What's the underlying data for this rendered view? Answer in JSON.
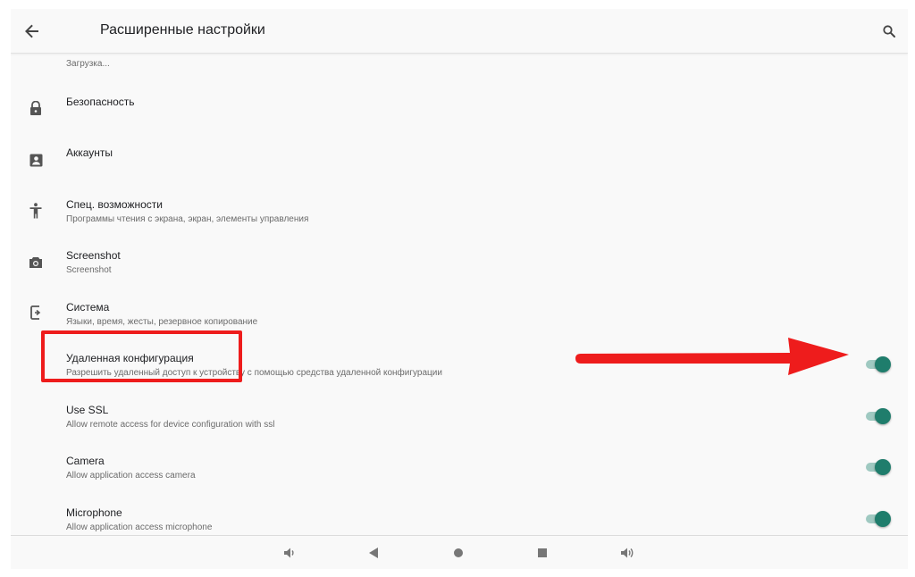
{
  "appbar": {
    "title": "Расширенные настройки",
    "back_icon": "arrow-back-icon",
    "search_icon": "search-icon"
  },
  "settings": {
    "partial_top": {
      "subtitle": "Загрузка..."
    },
    "items": [
      {
        "title": "Безопасность",
        "subtitle": "",
        "icon": "lock-icon"
      },
      {
        "title": "Аккаунты",
        "subtitle": "",
        "icon": "account-box-icon"
      },
      {
        "title": "Спец. возможности",
        "subtitle": "Программы чтения с экрана, экран, элементы управления",
        "icon": "accessibility-icon"
      },
      {
        "title": "Screenshot",
        "subtitle": "Screenshot",
        "icon": "camera-icon"
      },
      {
        "title": "Система",
        "subtitle": "Языки, время, жесты, резервное копирование",
        "icon": "system-icon"
      },
      {
        "title": "Удаленная конфигурация",
        "subtitle": "Разрешить удаленный доступ к устройству с помощью средства удаленной конфигурации",
        "toggle": true
      },
      {
        "title": "Use SSL",
        "subtitle": "Allow remote access for device configuration with ssl",
        "toggle": true
      },
      {
        "title": "Camera",
        "subtitle": "Allow application access camera",
        "toggle": true
      },
      {
        "title": "Microphone",
        "subtitle": "Allow application access microphone",
        "toggle": true
      }
    ]
  },
  "navbar": {
    "buttons": [
      "volume-down-icon",
      "back-triangle-icon",
      "home-circle-icon",
      "recents-square-icon",
      "volume-up-icon"
    ]
  },
  "colors": {
    "accent": "#1f7d6c",
    "toggle_track": "#9fc9c1",
    "annotation_red": "#ee1c1c"
  }
}
